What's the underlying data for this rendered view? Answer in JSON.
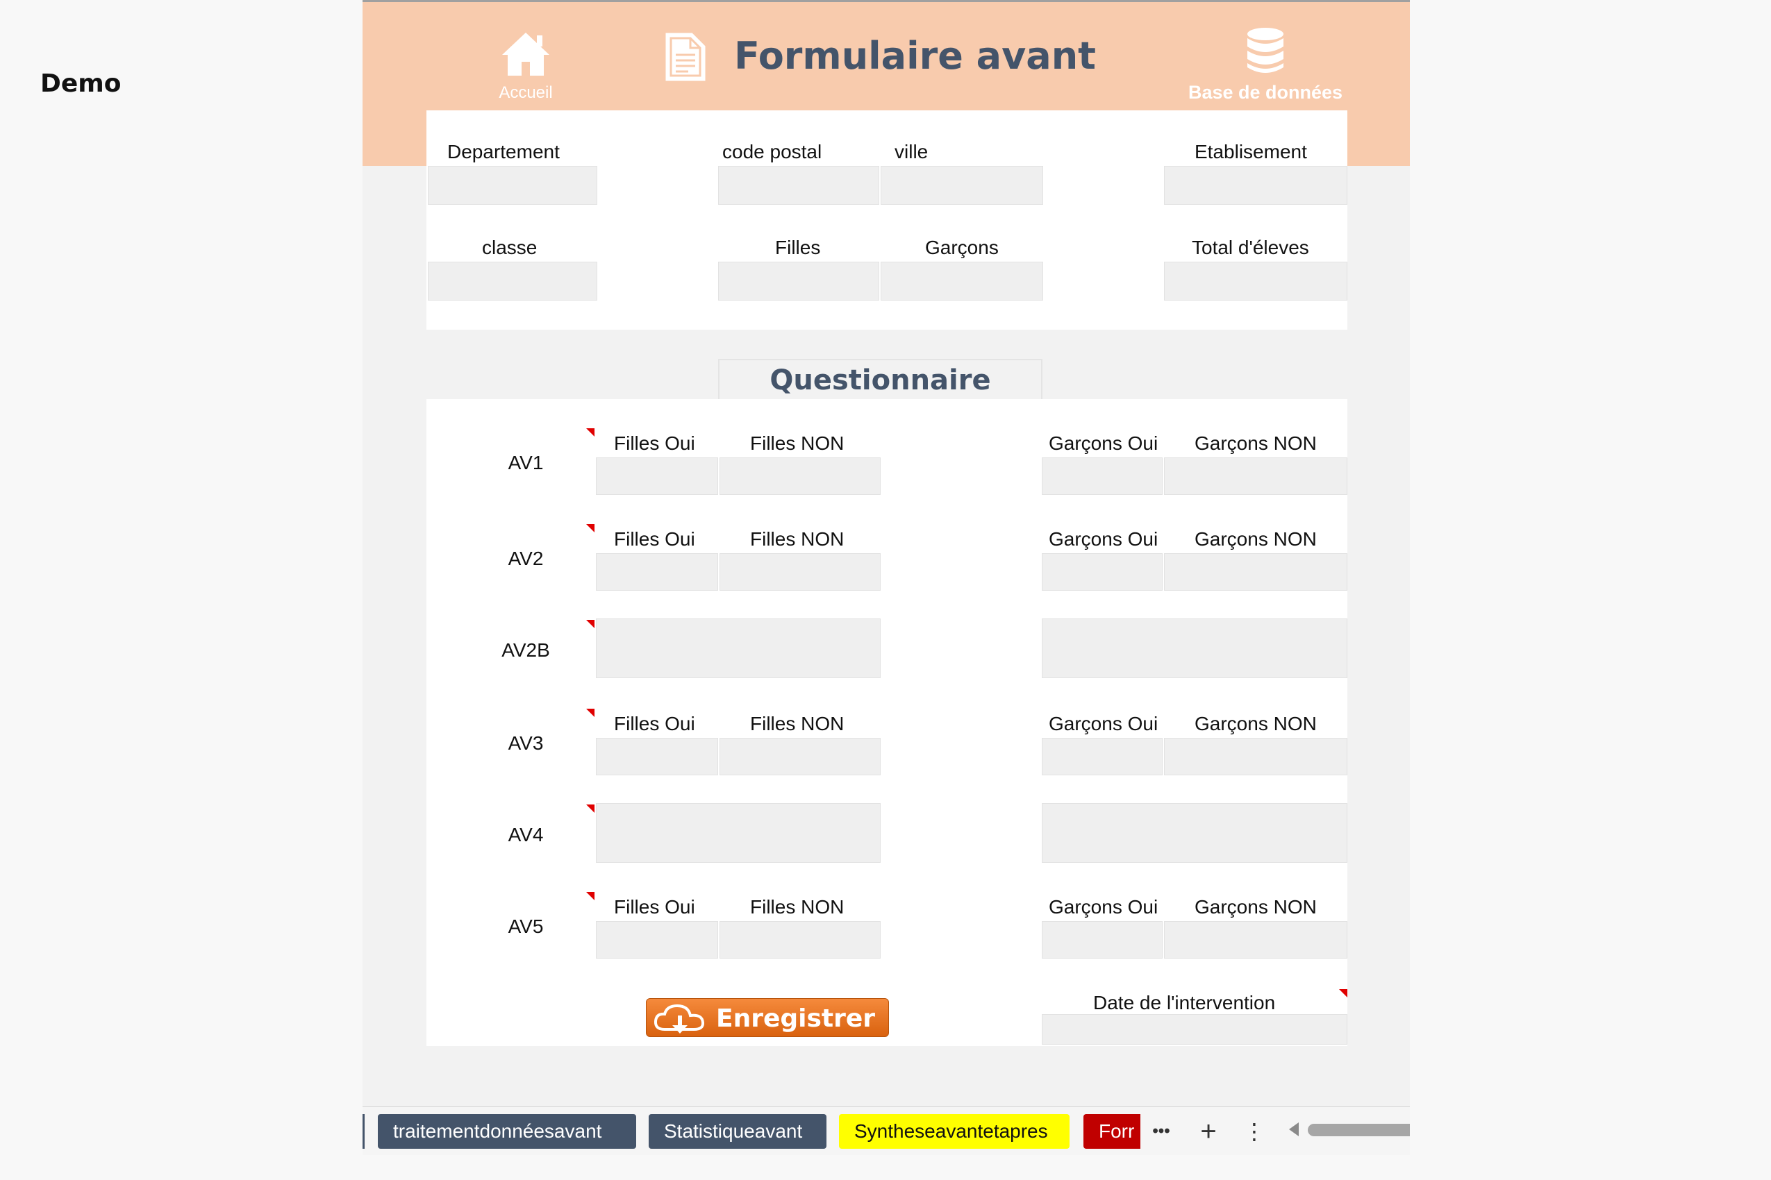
{
  "demo_label": "Demo",
  "header": {
    "home_label": "Accueil",
    "title": "Formulaire avant",
    "database_label": "Base de données",
    "home_icon": "home-icon",
    "document_icon": "document-icon",
    "database_icon": "database-icon",
    "bg_color": "#f8cbad",
    "title_color": "#44546a"
  },
  "fields": {
    "departement": "Departement",
    "code_postal": "code postal",
    "ville": "ville",
    "etablissement": "Etablisement",
    "classe": "classe",
    "filles": "Filles",
    "garcons": "Garçons",
    "total": "Total d'éleves"
  },
  "questionnaire": {
    "title": "Questionnaire",
    "rows": [
      {
        "id": "AV1",
        "filles_oui": "Filles Oui",
        "filles_non": "Filles NON",
        "garcons_oui": "Garçons Oui",
        "garcons_non": "Garçons NON"
      },
      {
        "id": "AV2",
        "filles_oui": "Filles Oui",
        "filles_non": "Filles NON",
        "garcons_oui": "Garçons Oui",
        "garcons_non": "Garçons NON"
      },
      {
        "id": "AV2B"
      },
      {
        "id": "AV3",
        "filles_oui": "Filles Oui",
        "filles_non": "Filles NON",
        "garcons_oui": "Garçons Oui",
        "garcons_non": "Garçons NON"
      },
      {
        "id": "AV4"
      },
      {
        "id": "AV5",
        "filles_oui": "Filles Oui",
        "filles_non": "Filles NON",
        "garcons_oui": "Garçons Oui",
        "garcons_non": "Garçons NON"
      }
    ],
    "date_label": "Date de l'intervention",
    "save_label": "Enregistrer",
    "save_icon": "cloud-download-icon",
    "save_color": "#e8731e"
  },
  "tabs": [
    {
      "label": "traitementdonnéesavant",
      "style": "dark"
    },
    {
      "label": "Statistiqueavant",
      "style": "dark"
    },
    {
      "label": "Syntheseavantetapres",
      "style": "yellow"
    },
    {
      "label": "Forr",
      "style": "red"
    }
  ],
  "tab_controls": {
    "more": "•••",
    "add": "+",
    "menu": "⋮"
  }
}
